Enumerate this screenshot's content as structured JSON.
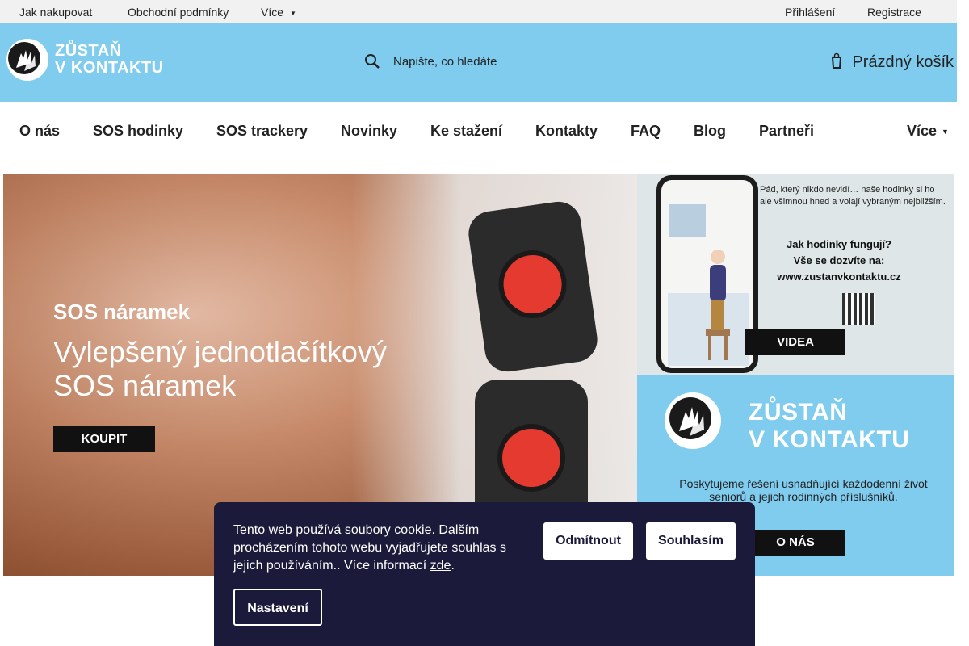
{
  "topbar": {
    "links": [
      "Jak nakupovat",
      "Obchodní podmínky",
      "Více"
    ],
    "login": "Přihlášení",
    "register": "Registrace"
  },
  "header": {
    "logo_line1": "ZŮSTAŇ",
    "logo_line2": "V KONTAKTU",
    "search_placeholder": "Napište, co hledáte",
    "cart_label": "Prázdný košík"
  },
  "nav": {
    "items": [
      "O nás",
      "SOS hodinky",
      "SOS trackery",
      "Novinky",
      "Ke stažení",
      "Kontakty",
      "FAQ",
      "Blog",
      "Partneři"
    ],
    "more": "Více"
  },
  "banners": {
    "main": {
      "subtitle": "SOS náramek",
      "headline_line1": "Vylepšený jednotlačítkový",
      "headline_line2": "SOS náramek",
      "cta": "KOUPIT"
    },
    "top_right": {
      "caption": "Pád, který nikdo nevidí… naše hodinky si ho ale všimnou hned a volají vybraným nejbližším.",
      "question_line1": "Jak hodinky fungují?",
      "question_line2": "Vše se dozvíte na:",
      "url": "www.zustanvkontaktu.cz",
      "cta": "VIDEA"
    },
    "bottom_right": {
      "title_line1": "ZŮSTAŇ",
      "title_line2": "V KONTAKTU",
      "text": "Poskytujeme řešení usnadňující každodenní život seniorů a jejich rodinných příslušníků.",
      "cta": "O NÁS"
    }
  },
  "cookie": {
    "message": "Tento web používá soubory cookie. Dalším procházením tohoto webu vyjadřujete souhlas s jejich používáním.. Více informací ",
    "link": "zde",
    "period": ".",
    "decline": "Odmítnout",
    "accept": "Souhlasím",
    "settings": "Nastavení"
  },
  "colors": {
    "brand_blue": "#80ccee",
    "cookie_bg": "#1b1a3a",
    "topbar_bg": "#f1f1f1"
  },
  "icons": [
    "chevron-down-icon",
    "search-icon",
    "cart-icon",
    "logo-hands-icon"
  ]
}
